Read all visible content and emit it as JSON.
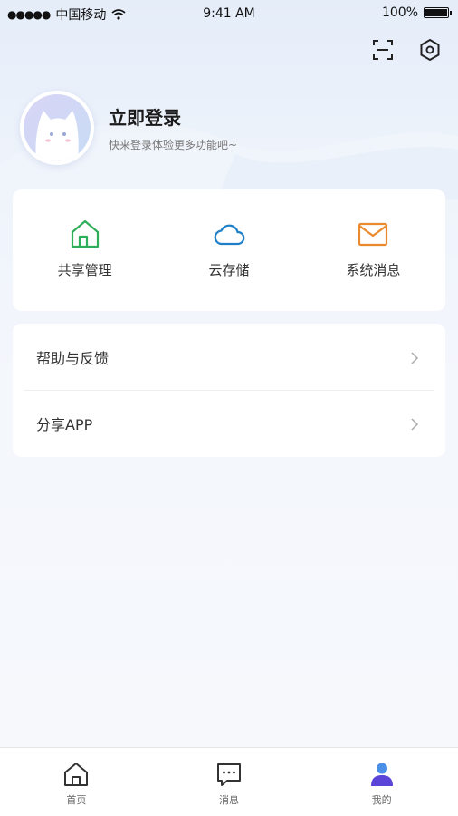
{
  "status_bar": {
    "carrier": "中国移动",
    "time": "9:41 AM",
    "battery": "100%",
    "battery_level": 1.0
  },
  "profile": {
    "title": "立即登录",
    "subtitle": "快来登录体验更多功能吧~"
  },
  "top_icons": {
    "scan": "scan-icon",
    "settings": "settings-icon"
  },
  "quick_actions": [
    {
      "label": "共享管理",
      "icon": "home-share-icon",
      "color": "#2fae5a"
    },
    {
      "label": "云存储",
      "icon": "cloud-icon",
      "color": "#1f7fc6"
    },
    {
      "label": "系统消息",
      "icon": "mail-icon",
      "color": "#ea8a2c"
    }
  ],
  "menu": [
    {
      "label": "帮助与反馈"
    },
    {
      "label": "分享APP"
    }
  ],
  "tabs": [
    {
      "label": "首页",
      "icon": "home-icon"
    },
    {
      "label": "消息",
      "icon": "message-icon"
    },
    {
      "label": "我的",
      "icon": "user-icon",
      "active": true,
      "color": "#5b45d8"
    }
  ]
}
